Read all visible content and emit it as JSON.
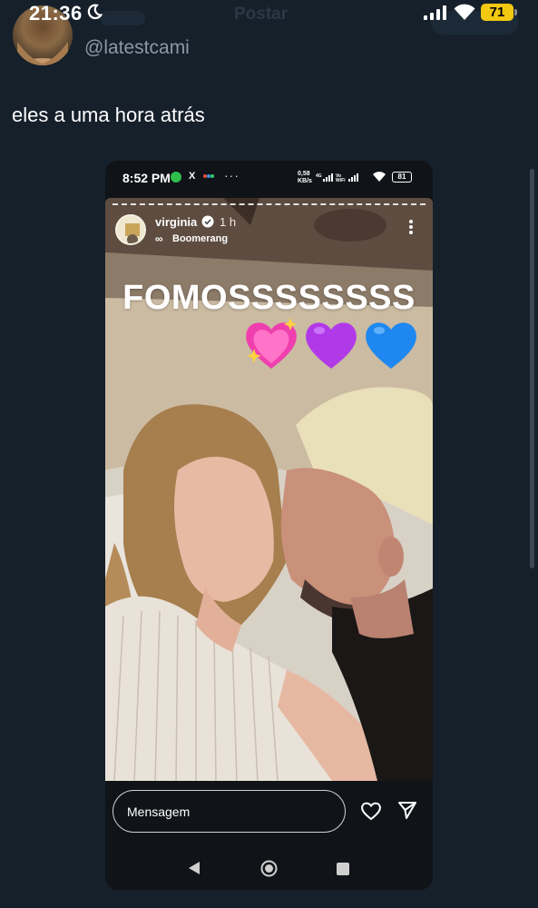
{
  "status_bar": {
    "time": "21:36",
    "battery": "71"
  },
  "ghost_header": {
    "title": "Postar"
  },
  "tweet": {
    "handle": "@latestcami",
    "text": "eles a uma hora atrás"
  },
  "embedded_screenshot": {
    "status_bar": {
      "time": "8:52 PM",
      "x_label": "X",
      "more": "···",
      "net_speed_value": "0,58",
      "net_speed_unit": "KB/s",
      "battery": "81"
    },
    "story": {
      "username": "virginia",
      "time_ago": "1 h",
      "effect_icon": "∞",
      "effect": "Boomerang",
      "overlay_text": "FOMOSSSSSSSS",
      "emojis": [
        "sparkling-heart",
        "purple-heart",
        "blue-heart"
      ]
    },
    "reply": {
      "placeholder": "Mensagem"
    }
  }
}
